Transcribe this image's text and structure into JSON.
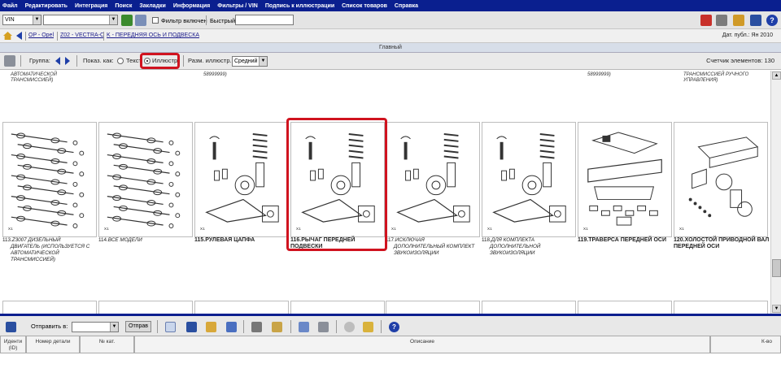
{
  "menu": [
    "Файл",
    "Редактировать",
    "Интеграция",
    "Поиск",
    "Закладки",
    "Информация",
    "Фильтры / VIN",
    "Подпись к иллюстрации",
    "Список товаров",
    "Справка"
  ],
  "toolbar": {
    "vin_select": "VIN",
    "filter_label": "Фильтр включен",
    "quick_label": "Быстрый:"
  },
  "breadcrumb": {
    "items": [
      "OP - Opel",
      "Z02 - VECTRA-C",
      "K - ПЕРЕДНЯЯ ОСЬ И ПОДВЕСКА"
    ],
    "date": "Дат. публ.: Ян 2010"
  },
  "panel_title": "Главный",
  "viewbar": {
    "group_label": "Группа:",
    "show_as_label": "Показ. как:",
    "text_option": "Текст",
    "illus_option": "Иллюстр.",
    "size_label": "Разм. иллюстр.:",
    "size_value": "Средний",
    "counter": "Счетчик элементов: 130"
  },
  "prev_row": [
    "АВТОМАТИЧЕСКОЙ\nТРАНСМИССИЕЙ)",
    "58999999)",
    "58999999)",
    "ТРАНСМИССИЕЙ РУЧНОГО\nУПРАВЛЕНИЯ)"
  ],
  "items": [
    {
      "num": "113.",
      "title": "Z3007 ДИЗЕЛЬНЫЙ",
      "desc": "ДВИГАТЕЛЬ (ИСПОЛЬЗУЕТСЯ С\nАВТОМАТИЧЕСКОЙ\nТРАНСМИССИЕЙ)",
      "bold": false
    },
    {
      "num": "114.",
      "title": "ВСЕ МОДЕЛИ",
      "desc": "",
      "bold": false
    },
    {
      "num": "115.",
      "title": "РУЛЕВАЯ ЦАПФА",
      "desc": "",
      "bold": true
    },
    {
      "num": "116.",
      "title": "РЫЧАГ ПЕРЕДНЕЙ ПОДВЕСКИ",
      "desc": "",
      "bold": true
    },
    {
      "num": "117.",
      "title": "ИСКЛЮЧАЯ",
      "desc": "ДОПОЛНИТЕЛЬНЫЙ КОМПЛЕКТ\nЗВУКОИЗОЛЯЦИИ",
      "bold": false
    },
    {
      "num": "118.",
      "title": "ДЛЯ КОМПЛЕКТА",
      "desc": "ДОПОЛНИТЕЛЬНОЙ\nЗВУКОИЗОЛЯЦИИ",
      "bold": false
    },
    {
      "num": "119.",
      "title": "ТРАВЕРСА ПЕРЕДНЕЙ ОСИ",
      "desc": "",
      "bold": true
    },
    {
      "num": "120.",
      "title": "ХОЛОСТОЙ ПРИВОДНОЙ ВАЛ",
      "desc": "ПЕРЕДНЕЙ ОСИ",
      "bold": true
    }
  ],
  "bottom": {
    "send_label": "Отправить в:",
    "send_button": "Отправ"
  },
  "table": {
    "headers": [
      "Иденти\n(ID)",
      "Номер детали",
      "№ кат.",
      "Описание",
      "К-во"
    ]
  }
}
